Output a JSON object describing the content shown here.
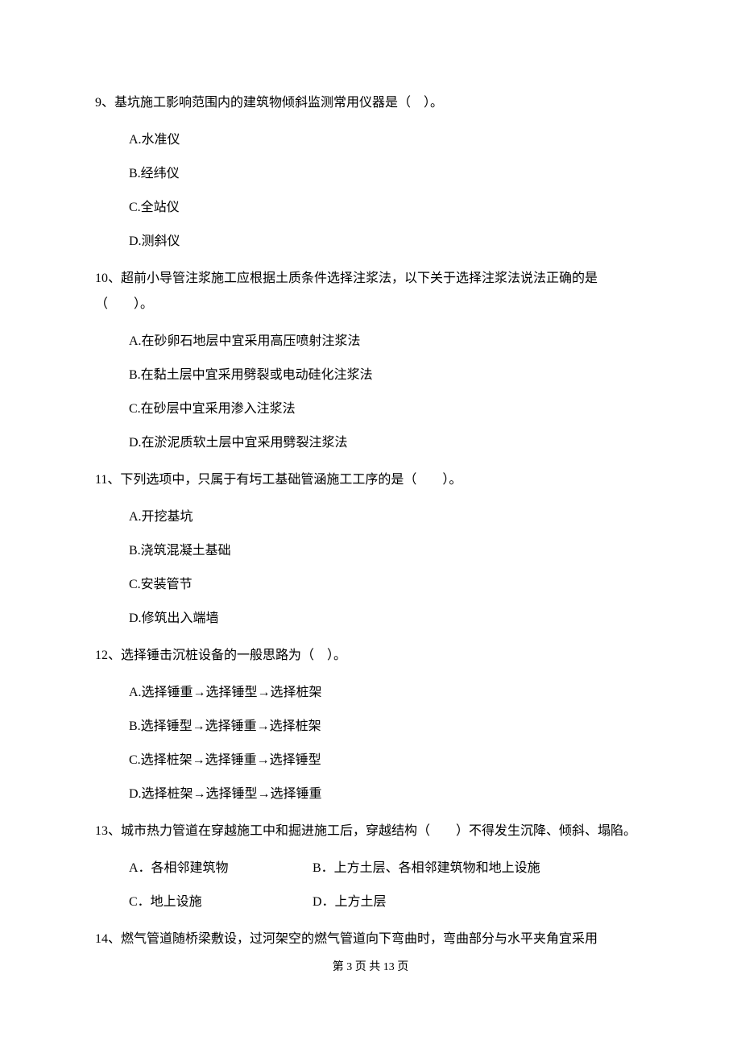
{
  "questions": [
    {
      "num": "9、",
      "text": "基坑施工影响范围内的建筑物倾斜监测常用仪器是（　）。",
      "options": [
        "A.水准仪",
        "B.经纬仪",
        "C.全站仪",
        "D.测斜仪"
      ]
    },
    {
      "num": "10、",
      "text": "超前小导管注浆施工应根据土质条件选择注浆法，以下关于选择注浆法说法正确的是（　　）。",
      "options": [
        "A.在砂卵石地层中宜采用高压喷射注浆法",
        "B.在黏土层中宜采用劈裂或电动硅化注浆法",
        "C.在砂层中宜采用渗入注浆法",
        "D.在淤泥质软土层中宜采用劈裂注浆法"
      ]
    },
    {
      "num": "11、",
      "text": "下列选项中，只属于有圬工基础管涵施工工序的是（　　）。",
      "options": [
        "A.开挖基坑",
        "B.浇筑混凝土基础",
        "C.安装管节",
        "D.修筑出入端墙"
      ]
    },
    {
      "num": "12、",
      "text": "选择锤击沉桩设备的一般思路为（　）。",
      "options": [
        "A.选择锤重→选择锤型→选择桩架",
        "B.选择锤型→选择锤重→选择桩架",
        "C.选择桩架→选择锤重→选择锤型",
        "D.选择桩架→选择锤型→选择锤重"
      ]
    },
    {
      "num": "13、",
      "text": "城市热力管道在穿越施工中和掘进施工后，穿越结构（　　）不得发生沉降、倾斜、塌陷。",
      "options_inline": [
        {
          "a": "A．各相邻建筑物",
          "b": "B．上方土层、各相邻建筑物和地上设施"
        },
        {
          "a": "C．地上设施",
          "b": "D．上方土层"
        }
      ]
    },
    {
      "num": "14、",
      "text": "燃气管道随桥梁敷设，过河架空的燃气管道向下弯曲时，弯曲部分与水平夹角宜采用"
    }
  ],
  "footer": "第 3 页 共 13 页"
}
